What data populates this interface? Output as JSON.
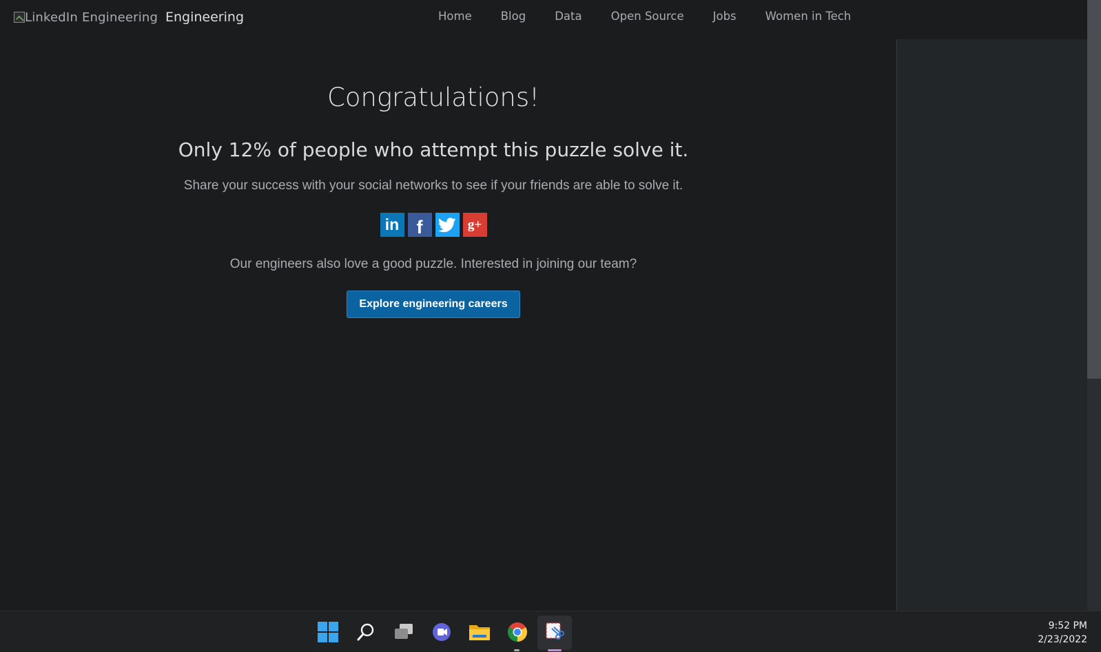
{
  "header": {
    "logo_alt": "LinkedIn Engineering",
    "site_title": "Engineering",
    "nav": [
      "Home",
      "Blog",
      "Data",
      "Open Source",
      "Jobs",
      "Women in Tech"
    ]
  },
  "main": {
    "headline": "Congratulations!",
    "subline": "Only 12% of people who attempt this puzzle solve it.",
    "share_text": "Share your success with your social networks to see if your friends are able to solve it.",
    "social": {
      "linkedin_glyph": "in",
      "facebook_glyph": "f",
      "google_glyph": "g+"
    },
    "team_text": "Our engineers also love a good puzzle. Interested in joining our team?",
    "careers_button": "Explore engineering careers"
  },
  "taskbar": {
    "icons": [
      "windows-start-icon",
      "search-icon",
      "task-view-icon",
      "teams-chat-icon",
      "file-explorer-icon",
      "chrome-icon",
      "snipping-tool-icon"
    ],
    "time": "9:52 PM",
    "date": "2/23/2022"
  },
  "colors": {
    "background": "#1b1c1e",
    "accent_button": "#0b64a0",
    "linkedin": "#0b77b5",
    "facebook": "#3b5a9a",
    "twitter": "#1da1f2",
    "google": "#d73d32"
  }
}
